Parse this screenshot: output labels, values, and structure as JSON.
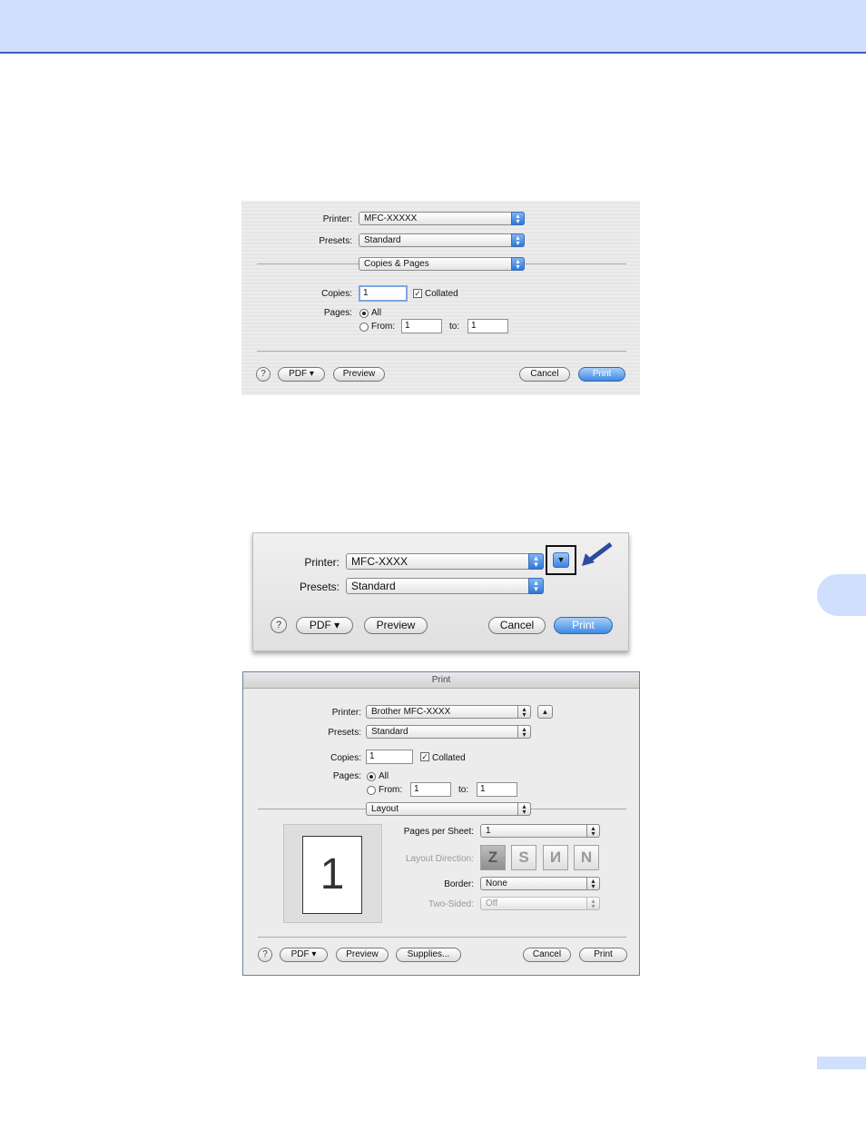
{
  "dialog1": {
    "printer_label": "Printer:",
    "printer_value": "MFC-XXXXX",
    "presets_label": "Presets:",
    "presets_value": "Standard",
    "panel_value": "Copies & Pages",
    "copies_label": "Copies:",
    "copies_value": "1",
    "collated_label": "Collated",
    "pages_label": "Pages:",
    "all_label": "All",
    "from_label": "From:",
    "from_value": "1",
    "to_label": "to:",
    "to_value": "1",
    "help": "?",
    "pdf": "PDF ▾",
    "preview": "Preview",
    "cancel": "Cancel",
    "print": "Print"
  },
  "dialog2": {
    "printer_label": "Printer:",
    "printer_value": "MFC-XXXX",
    "presets_label": "Presets:",
    "presets_value": "Standard",
    "help": "?",
    "pdf": "PDF ▾",
    "preview": "Preview",
    "cancel": "Cancel",
    "print": "Print"
  },
  "dialog3": {
    "title": "Print",
    "printer_label": "Printer:",
    "printer_value": "Brother MFC-XXXX",
    "presets_label": "Presets:",
    "presets_value": "Standard",
    "copies_label": "Copies:",
    "copies_value": "1",
    "collated_label": "Collated",
    "pages_label": "Pages:",
    "all_label": "All",
    "from_label": "From:",
    "from_value": "1",
    "to_label": "to:",
    "to_value": "1",
    "panel_value": "Layout",
    "preview_number": "1",
    "pps_label": "Pages per Sheet:",
    "pps_value": "1",
    "direction_label": "Layout Direction:",
    "direction_glyphs": [
      "Z",
      "S",
      "N",
      "N"
    ],
    "border_label": "Border:",
    "border_value": "None",
    "twosided_label": "Two-Sided:",
    "twosided_value": "Off",
    "help": "?",
    "pdf": "PDF ▾",
    "preview": "Preview",
    "supplies": "Supplies...",
    "cancel": "Cancel",
    "print": "Print"
  },
  "colors": {
    "accent_band": "#cfdffd",
    "accent_rule": "#3d5fb8",
    "callout_arrow": "#2c4aa0"
  }
}
